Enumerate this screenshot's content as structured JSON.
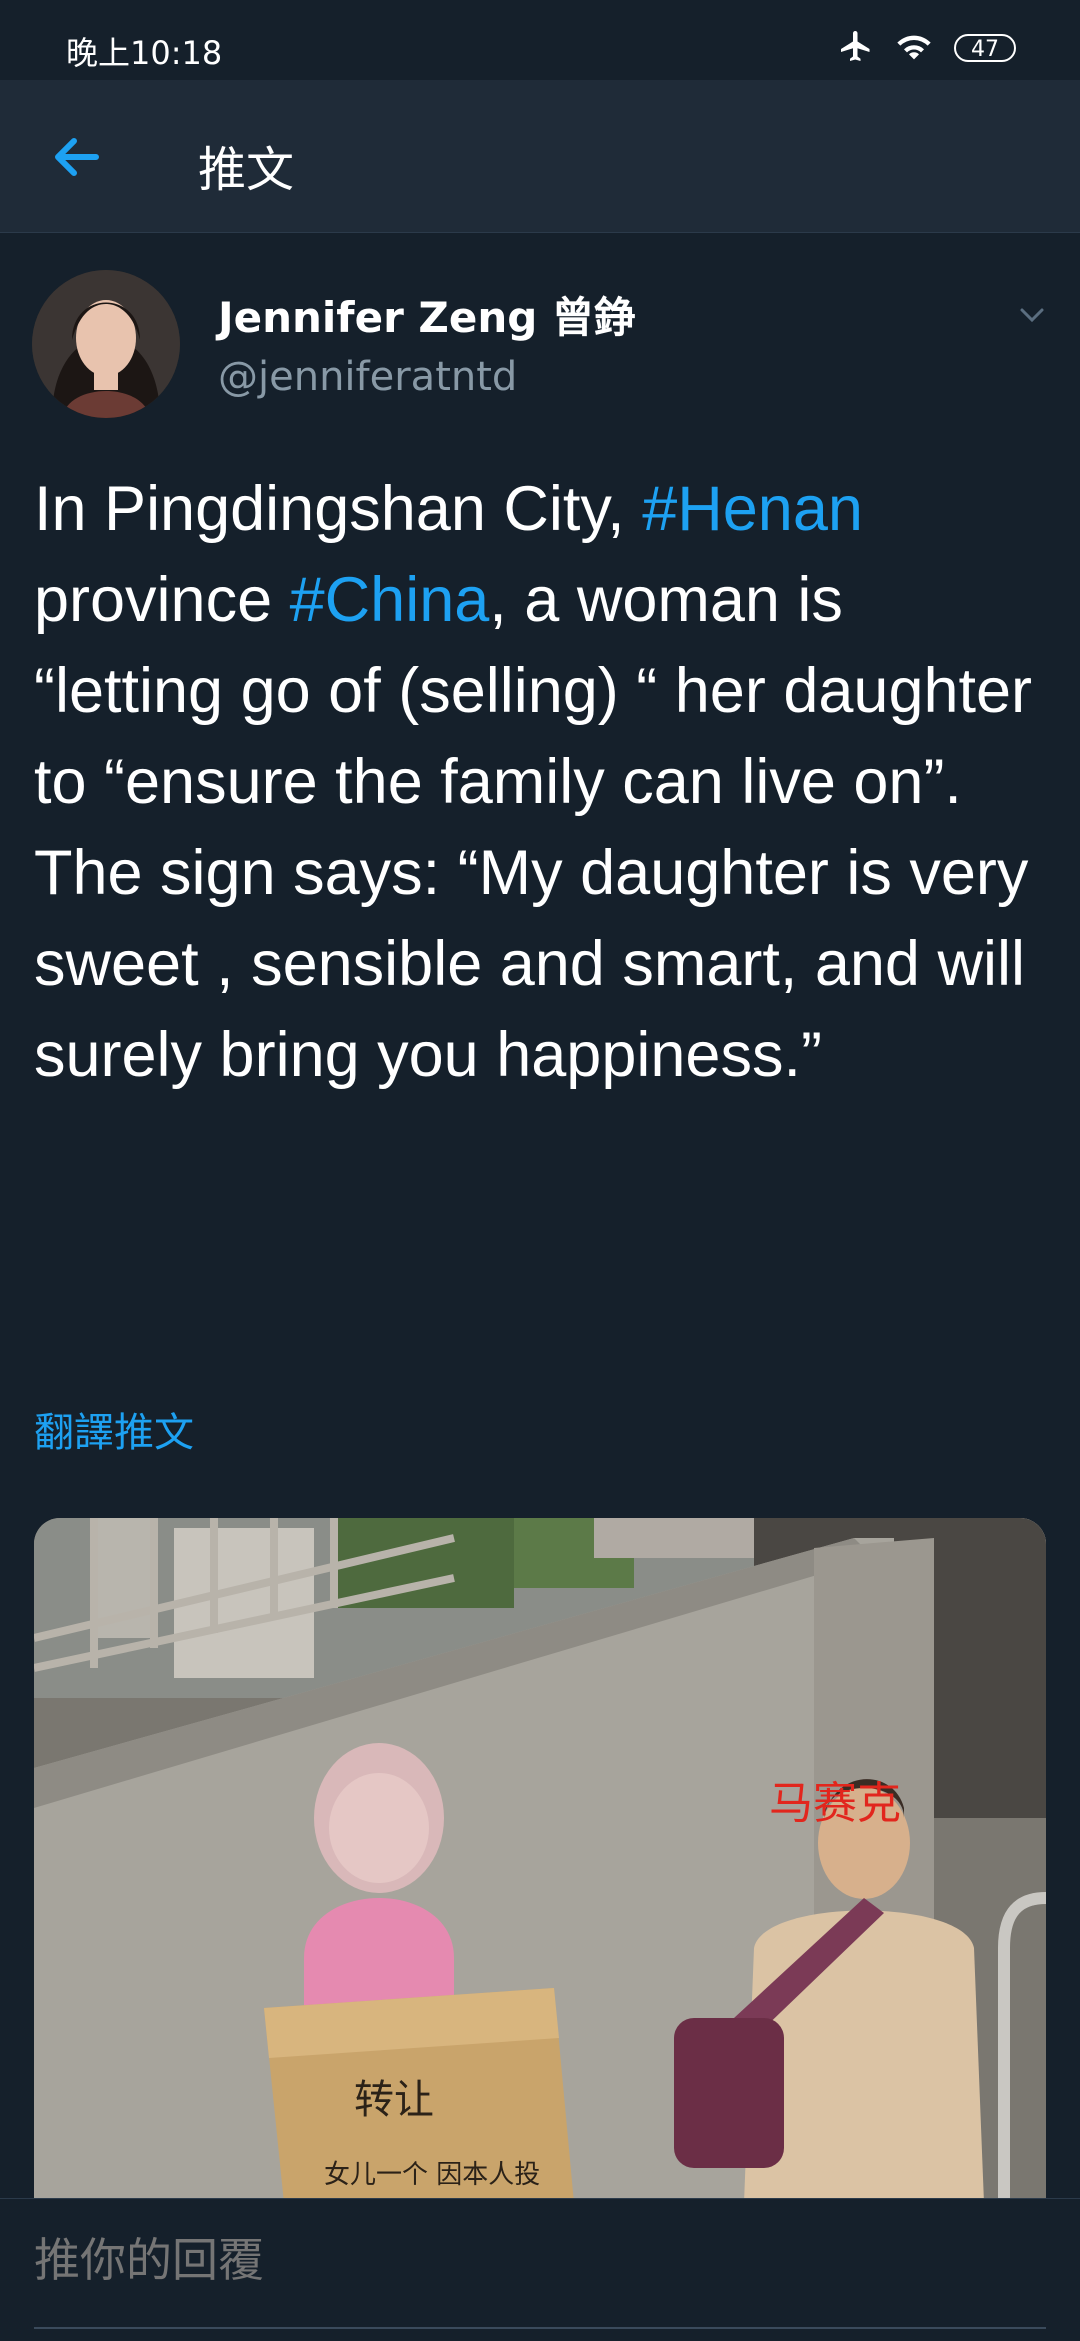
{
  "status_bar": {
    "time": "晚上10:18",
    "battery": "47",
    "icons": [
      "airplane-icon",
      "wifi-icon",
      "battery-icon"
    ]
  },
  "app_bar": {
    "title": "推文",
    "back_icon": "back-arrow-icon"
  },
  "tweet": {
    "author_name": "Jennifer Zeng 曾錚",
    "handle": "@jenniferatntd",
    "text_parts": {
      "p1": "In Pingdingshan City, ",
      "tag1": "#Henan",
      "p2": " province ",
      "tag2": "#China",
      "p3": ", a woman is “letting go of (selling) “ her daughter to “ensure the family can live on”. The sign says: “My daughter is very sweet , sensible and smart, and will surely bring you happiness.”"
    },
    "translate_label": "翻譯推文",
    "media": {
      "watermark": "马赛克",
      "sign_text_line1": "转让",
      "sign_text_line2": "女儿一个 因本人投"
    }
  },
  "reply": {
    "placeholder": "推你的回覆"
  },
  "colors": {
    "background": "#15202b",
    "app_bar": "#1f2b38",
    "accent": "#1da1f2",
    "secondary_text": "#8899a6"
  }
}
